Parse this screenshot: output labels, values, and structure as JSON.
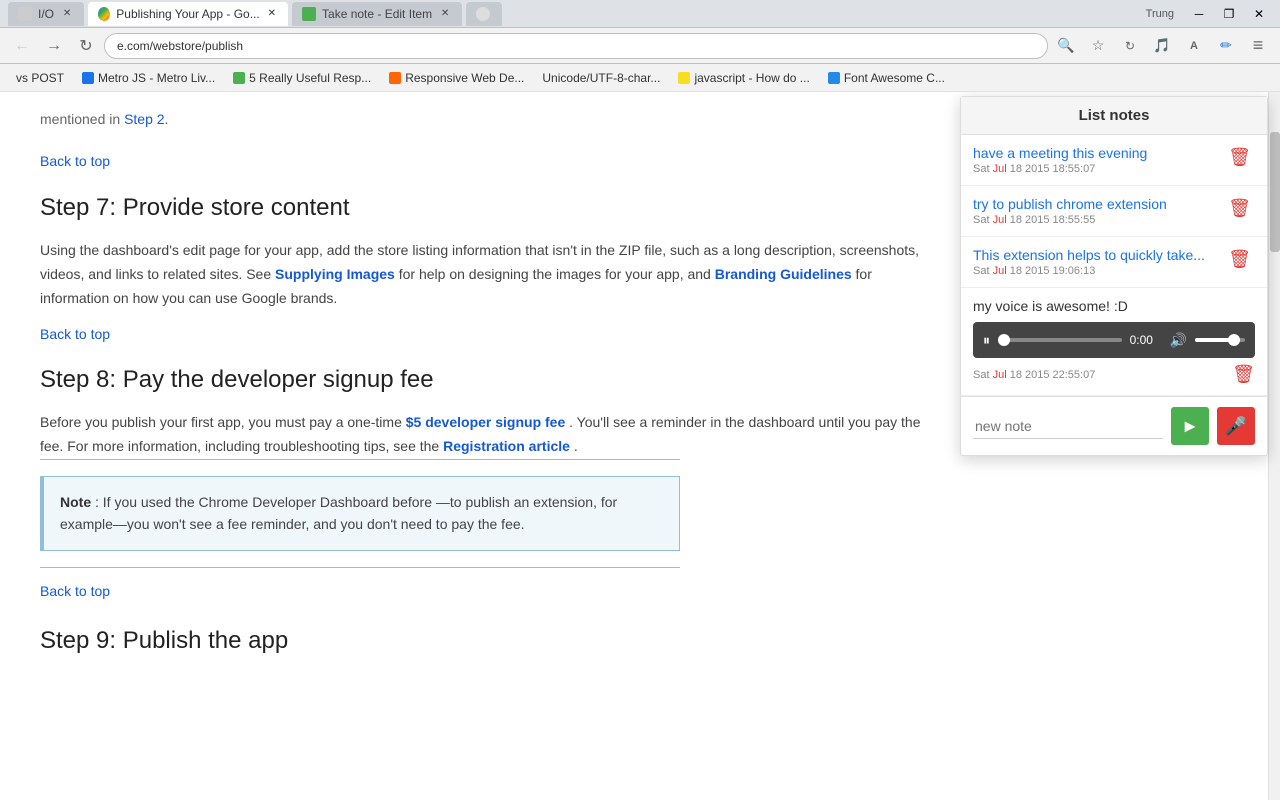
{
  "browser": {
    "tabs": [
      {
        "id": "tab1",
        "label": "I/O",
        "title": "I/O",
        "active": false,
        "favicon_type": "plain"
      },
      {
        "id": "tab2",
        "label": "Publishing Your App - Go...",
        "title": "Publishing Your App - Google Chrome",
        "active": true,
        "favicon_type": "chrome"
      },
      {
        "id": "tab3",
        "label": "Take note - Edit Item",
        "title": "Take note - Edit Item",
        "active": false,
        "favicon_type": "note"
      },
      {
        "id": "tab4",
        "label": "",
        "title": "",
        "active": false,
        "favicon_type": "plain"
      }
    ],
    "window_controls": {
      "minimize": "─",
      "restore": "❐",
      "close": "✕"
    },
    "address": "e.com/webstore/publish",
    "user": "Trung",
    "bookmarks": [
      {
        "label": "vs POST"
      },
      {
        "label": "Metro JS - Metro Liv..."
      },
      {
        "label": "5 Really Useful Resp..."
      },
      {
        "label": "Responsive Web De..."
      },
      {
        "label": "Unicode/UTF-8-char..."
      },
      {
        "label": "javascript - How do ..."
      },
      {
        "label": "Font Awesome C..."
      }
    ]
  },
  "webpage": {
    "step_intro_text": "mentioned in",
    "step_intro_link": "Step 2.",
    "back_to_top_1": "Back to top",
    "step7_heading": "Step 7: Provide store content",
    "step7_body1": "Using the dashboard's edit page for your app, add the store listing information that isn't in the ZIP file, such as a long description, screenshots, videos, and links to related sites. See",
    "step7_link1": "Supplying Images",
    "step7_body2": "for help on designing the images for your app, and",
    "step7_link2": "Branding Guidelines",
    "step7_body3": "for information on how you can use Google brands.",
    "back_to_top_2": "Back to top",
    "step8_heading": "Step 8: Pay the developer signup fee",
    "step8_body1": "Before you publish your first app, you must pay a one-time",
    "step8_link1": "$5 developer signup fee",
    "step8_body2": ". You'll see a reminder in the dashboard until you pay the fee. For more information, including troubleshooting tips, see the",
    "step8_link2": "Registration article",
    "step8_body3": ".",
    "note_label": "Note",
    "note_body": ": If you used the Chrome Developer Dashboard before —to publish an extension, for example—you won't see a fee reminder, and you don't need to pay the fee.",
    "back_to_top_3": "Back to top",
    "step9_heading": "Step 9: Publish the app"
  },
  "panel": {
    "title": "List notes",
    "notes": [
      {
        "id": "note1",
        "title": "have a meeting this evening",
        "date_prefix": "Sat ",
        "date_highlight": "Jul",
        "date_suffix": " 18 2015 18:55:07",
        "type": "text"
      },
      {
        "id": "note2",
        "title": "try to publish chrome extension",
        "date_prefix": "Sat ",
        "date_highlight": "Jul",
        "date_suffix": " 18 2015 18:55:55",
        "type": "text"
      },
      {
        "id": "note3",
        "title": "This extension helps to quickly take...",
        "date_prefix": "Sat ",
        "date_highlight": "Jul",
        "date_suffix": " 18 2015 19:06:13",
        "type": "text"
      }
    ],
    "audio_note": {
      "title": "my voice is awesome! :D",
      "date_prefix": "Sat ",
      "date_highlight": "Jul",
      "date_suffix": " 18 2015 22:55:07",
      "time": "0:00"
    },
    "new_note_placeholder": "new note",
    "send_btn_label": "▶",
    "mic_btn_label": "🎤"
  },
  "icons": {
    "back_arrow": "←",
    "forward_arrow": "→",
    "refresh": "↻",
    "search": "🔍",
    "star": "☆",
    "extensions": "🔧",
    "translate": "A",
    "pen": "✏",
    "menu": "≡",
    "trash": "🗑",
    "mic": "🎙",
    "play": "▶",
    "pause": "⏸",
    "volume": "🔊"
  }
}
